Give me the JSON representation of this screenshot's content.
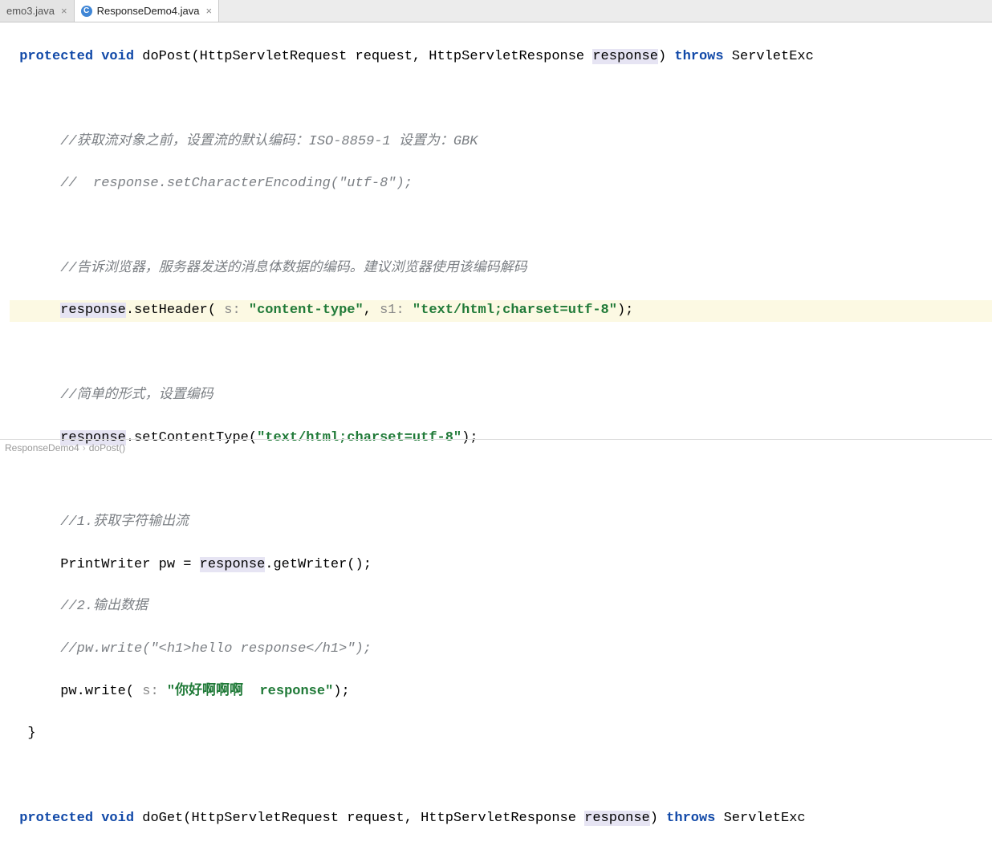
{
  "tabs": [
    {
      "label": "emo3.java",
      "active": false,
      "has_icon": false
    },
    {
      "label": "ResponseDemo4.java",
      "active": true,
      "has_icon": true,
      "icon_letter": "C"
    }
  ],
  "code": {
    "l1_a": "protected",
    "l1_b": " void",
    "l1_c": " doPost(HttpServletRequest request, HttpServletResponse ",
    "l1_resp": "response",
    "l1_d": ") ",
    "l1_e": "throws",
    "l1_f": " ServletExc",
    "c1": "//获取流对象之前，设置流的默认编码：ISO-8859-1 设置为：GBK",
    "c2": "//  response.setCharacterEncoding(\"utf-8\");",
    "c3": "//告诉浏览器，服务器发送的消息体数据的编码。建议浏览器使用该编码解码",
    "l4_a": "response",
    "l4_b": ".setHeader( ",
    "l4_h1": "s:",
    "l4_s1": " \"content-type\"",
    "l4_c": ", ",
    "l4_h2": "s1:",
    "l4_s2": " \"text/html;charset=utf-8\"",
    "l4_d": ");",
    "c4": "//简单的形式，设置编码",
    "l5_a": "response",
    "l5_b": ".setContentType(",
    "l5_s": "\"text/html;charset=utf-8\"",
    "l5_c": ");",
    "c5": "//1.获取字符输出流",
    "l6_a": "PrintWriter pw = ",
    "l6_resp": "response",
    "l6_b": ".getWriter();",
    "c6": "//2.输出数据",
    "c7": "//pw.write(\"<h1>hello response</h1>\");",
    "l7_a": "pw.write( ",
    "l7_h": "s:",
    "l7_s": " \"你好啊啊啊  response\"",
    "l7_b": ");",
    "brace": "}",
    "l8_a": "protected",
    "l8_b": " void",
    "l8_c": " doGet(HttpServletRequest request, HttpServletResponse ",
    "l8_resp": "response",
    "l8_d": ") ",
    "l8_e": "throws",
    "l8_f": " ServletExc"
  },
  "breadcrumb": {
    "a": "ResponseDemo4",
    "b": "doPost()"
  }
}
